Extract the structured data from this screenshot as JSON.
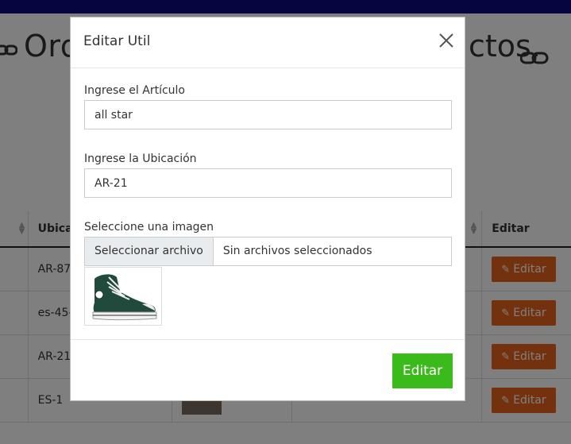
{
  "page": {
    "title_left": "Ord",
    "title_right": "ctos.",
    "table": {
      "headers": [
        "",
        "Ubica",
        "",
        "",
        "Editar"
      ],
      "rows": [
        {
          "ubicacion": "AR-87",
          "action": "Editar"
        },
        {
          "ubicacion": "es-45-",
          "action": "Editar"
        },
        {
          "ubicacion": "AR-21",
          "action": "Editar"
        },
        {
          "ubicacion": "ES-1",
          "action": "Editar"
        }
      ]
    }
  },
  "modal": {
    "title": "Editar Util",
    "articulo": {
      "label": "Ingrese el Artículo",
      "value": "all star"
    },
    "ubicacion": {
      "label": "Ingrese la Ubicación",
      "value": "AR-21"
    },
    "imagen": {
      "label": "Seleccione una imagen",
      "button": "Seleccionar archivo",
      "status": "Sin archivos seleccionados"
    },
    "submit": "Editar"
  },
  "colors": {
    "topbar": "#0a0a80",
    "edit_button": "#e8621a",
    "submit_button": "#3bba1c"
  }
}
